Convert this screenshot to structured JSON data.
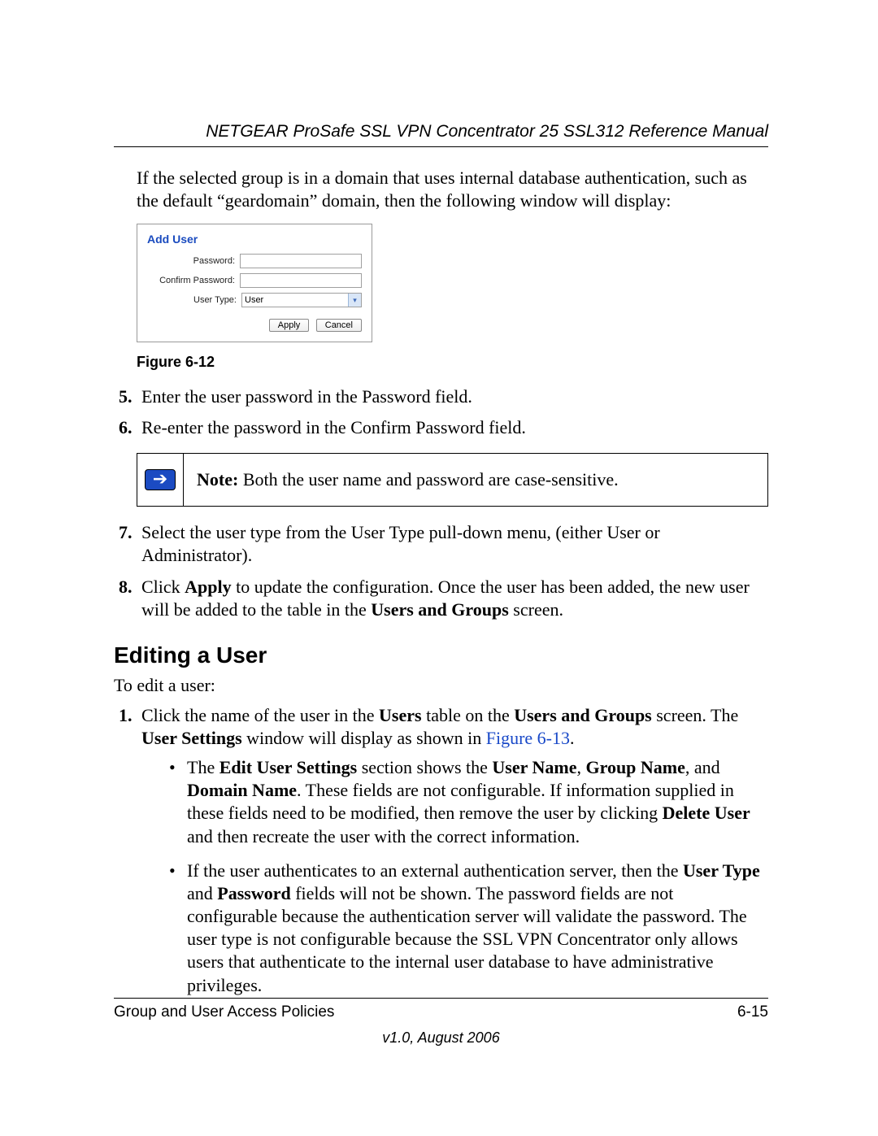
{
  "header": {
    "title": "NETGEAR ProSafe SSL VPN Concentrator 25 SSL312 Reference Manual"
  },
  "intro": {
    "text": "If the selected group is in a domain that uses internal database authentication, such as the default “geardomain” domain, then the following window will display:"
  },
  "figure": {
    "panel_title": "Add User",
    "labels": {
      "password": "Password:",
      "confirm": "Confirm Password:",
      "usertype": "User Type:"
    },
    "values": {
      "password": "",
      "confirm": "",
      "usertype": "User"
    },
    "buttons": {
      "apply": "Apply",
      "cancel": "Cancel"
    },
    "caption": "Figure 6-12"
  },
  "steps_a": {
    "s5": "Enter the user password in the Password field.",
    "s6": "Re-enter the password in the Confirm Password field."
  },
  "note": {
    "prefix": "Note: ",
    "text": "Both the user name and password are case-sensitive."
  },
  "steps_b": {
    "s7": "Select the user type from the User Type pull-down menu, (either User or Administrator).",
    "s8_before": "Click ",
    "s8_apply": "Apply",
    "s8_mid": " to update the configuration. Once the user has been added, the new user will be added to the table in the ",
    "s8_bold2": "Users and Groups",
    "s8_after": " screen."
  },
  "section": {
    "heading": "Editing a User",
    "lead": "To edit a user:"
  },
  "edit_steps": {
    "s1_a": "Click the name of the user in the ",
    "s1_b1": "Users",
    "s1_b": " table on the ",
    "s1_b2": "Users and Groups",
    "s1_c": " screen. The ",
    "s1_b3": "User Settings",
    "s1_d": " window will display as shown in ",
    "s1_link": "Figure 6-13",
    "s1_e": ".",
    "bul1_a": "The ",
    "bul1_b1": "Edit User Settings",
    "bul1_b": " section shows the ",
    "bul1_b2": "User Name",
    "bul1_c": ", ",
    "bul1_b3": "Group Name",
    "bul1_d": ", and ",
    "bul1_b4": "Domain Name",
    "bul1_e": ". These fields are not configurable. If information supplied in these fields need to be modified, then remove the user by clicking ",
    "bul1_b5": "Delete User",
    "bul1_f": " and then recreate the user with the correct information.",
    "bul2_a": "If the user authenticates to an external authentication server, then the ",
    "bul2_b1": "User Type",
    "bul2_b": " and ",
    "bul2_b2": "Password",
    "bul2_c": " fields will not be shown. The password fields are not configurable because the authentication server will validate the password. The user type is not configurable because the SSL VPN Concentrator only allows users that authenticate to the internal user database to have administrative privileges."
  },
  "footer": {
    "left": "Group and User Access Policies",
    "right": "6-15",
    "version": "v1.0, August 2006"
  }
}
